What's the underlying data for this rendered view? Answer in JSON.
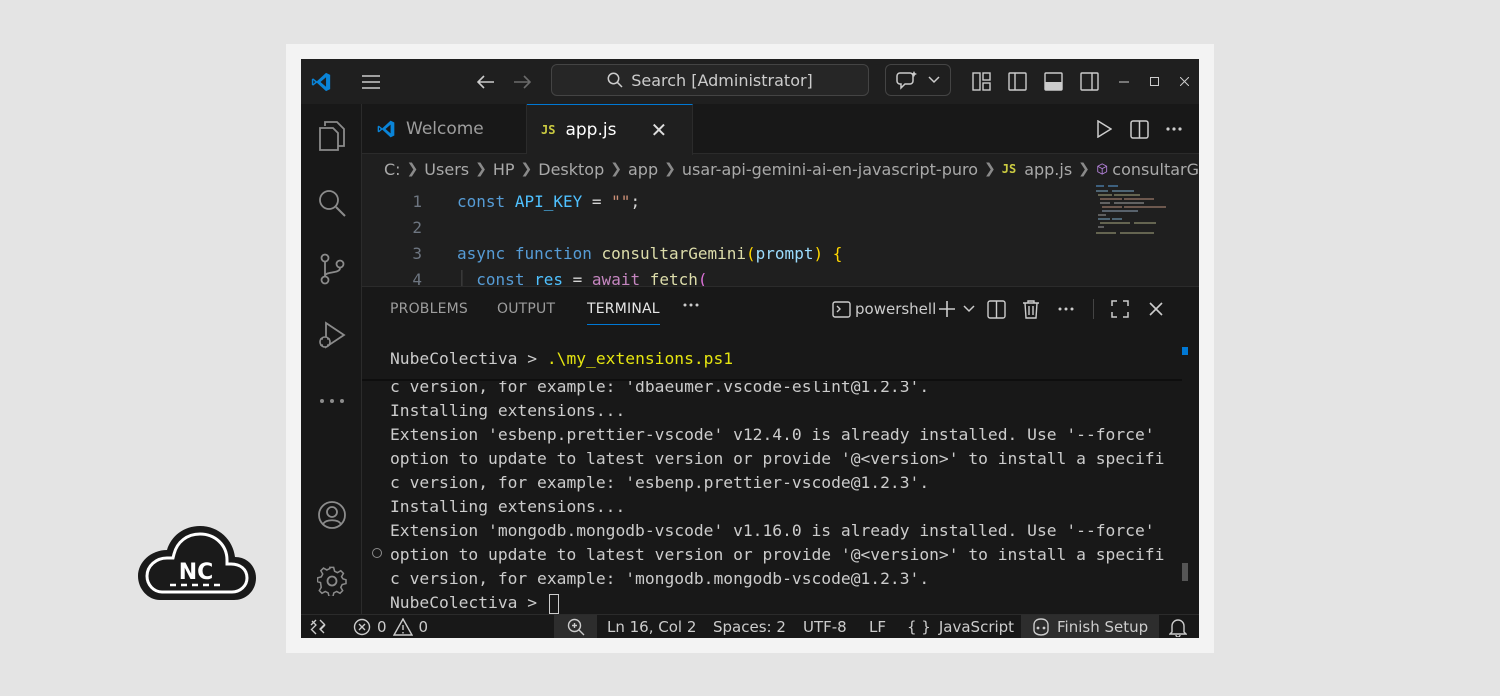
{
  "titlebar": {
    "search_placeholder": "Search [Administrator]"
  },
  "tabs": [
    {
      "label": "Welcome"
    },
    {
      "label": "app.js",
      "badge": "JS"
    }
  ],
  "breadcrumb": {
    "items": [
      "C:",
      "Users",
      "HP",
      "Desktop",
      "app",
      "usar-api-gemini-ai-en-javascript-puro",
      "app.js",
      "consultarG"
    ],
    "file_badge": "JS"
  },
  "code": {
    "line_numbers": [
      "1",
      "2",
      "3",
      "4"
    ]
  },
  "panel": {
    "tabs": [
      "PROBLEMS",
      "OUTPUT",
      "TERMINAL"
    ],
    "active_tab": "TERMINAL",
    "shell_label": "powershell"
  },
  "terminal": {
    "sticky_prompt": "NubeColectiva > ",
    "sticky_command": ".\\my_extensions.ps1",
    "lines": [
      "c version, for example: 'dbaeumer.vscode-eslint@1.2.3'.",
      "Installing extensions...",
      "Extension 'esbenp.prettier-vscode' v12.4.0 is already installed. Use '--force'",
      "option to update to latest version or provide '@<version>' to install a specifi",
      "c version, for example: 'esbenp.prettier-vscode@1.2.3'.",
      "Installing extensions...",
      "Extension 'mongodb.mongodb-vscode' v1.16.0 is already installed. Use '--force'",
      "option to update to latest version or provide '@<version>' to install a specifi",
      "c version, for example: 'mongodb.mongodb-vscode@1.2.3'."
    ],
    "current_prompt": "NubeColectiva > "
  },
  "statusbar": {
    "errors": "0",
    "warnings": "0",
    "cursor_position": "Ln 16, Col 2",
    "indentation": "Spaces: 2",
    "encoding": "UTF-8",
    "eol": "LF",
    "language": "JavaScript",
    "language_prefix": "{ }",
    "finish_setup": "Finish Setup"
  },
  "logo": {
    "text": "NC"
  },
  "colors": {
    "accent": "#0078d4",
    "editor_bg": "#1f1f1f",
    "sidebar_bg": "#181818"
  }
}
